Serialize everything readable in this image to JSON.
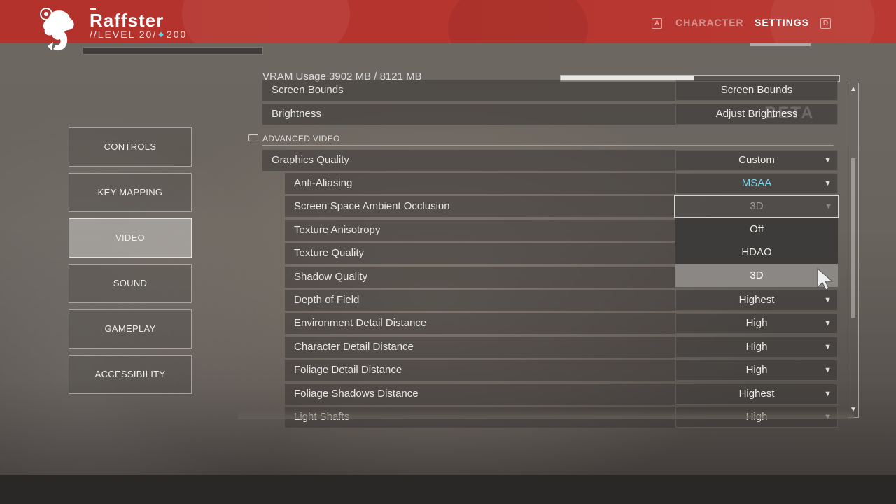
{
  "header": {
    "player_name": "Raffster",
    "level_text": "//LEVEL 20/",
    "power_value": "200",
    "nav_left_key": "A",
    "nav_right_key": "D",
    "tabs": [
      {
        "label": "CHARACTER",
        "active": false
      },
      {
        "label": "SETTINGS",
        "active": true
      }
    ],
    "accent_color": "#b3322c"
  },
  "sidebar": {
    "items": [
      {
        "label": "CONTROLS",
        "active": false
      },
      {
        "label": "KEY MAPPING",
        "active": false
      },
      {
        "label": "VIDEO",
        "active": true
      },
      {
        "label": "SOUND",
        "active": false
      },
      {
        "label": "GAMEPLAY",
        "active": false
      },
      {
        "label": "ACCESSIBILITY",
        "active": false
      }
    ]
  },
  "vram": {
    "label": "VRAM Usage 3902 MB / 8121 MB",
    "used_fraction": 0.48
  },
  "settings": {
    "basic_rows": [
      {
        "label": "Screen Bounds",
        "value": "Screen Bounds"
      },
      {
        "label": "Brightness",
        "value": "Adjust Brightness"
      }
    ],
    "section_title": "ADVANCED VIDEO",
    "graphics_quality": {
      "label": "Graphics Quality",
      "value": "Custom"
    },
    "rows": [
      {
        "label": "Anti-Aliasing",
        "value": "MSAA",
        "highlight": true
      },
      {
        "label": "Screen Space Ambient Occlusion",
        "value": "3D",
        "focused": true
      },
      {
        "label": "Texture Anisotropy",
        "value": ""
      },
      {
        "label": "Texture Quality",
        "value": ""
      },
      {
        "label": "Shadow Quality",
        "value": ""
      },
      {
        "label": "Depth of Field",
        "value": "Highest"
      },
      {
        "label": "Environment Detail Distance",
        "value": "High"
      },
      {
        "label": "Character Detail Distance",
        "value": "High"
      },
      {
        "label": "Foliage Detail Distance",
        "value": "High"
      },
      {
        "label": "Foliage Shadows Distance",
        "value": "Highest"
      },
      {
        "label": "Light Shafts",
        "value": "High"
      }
    ],
    "dropdown_options": [
      "Off",
      "HDAO",
      "3D"
    ],
    "dropdown_selected": "3D",
    "highlight_color": "#7dd4ea"
  },
  "watermark": "BETA"
}
